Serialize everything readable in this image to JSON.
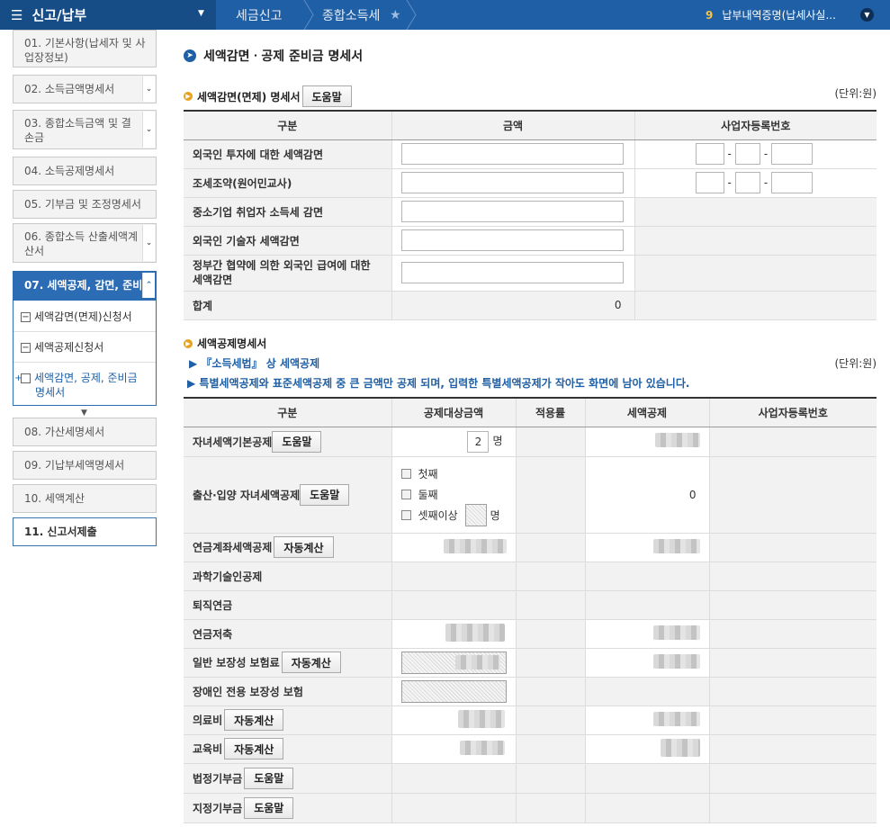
{
  "header": {
    "menu_title": "신고/납부",
    "breadcrumbs": [
      "세금신고",
      "종합소득세"
    ],
    "notify_count": "9",
    "notify_text": "납부내역증명(납세사실...",
    "colors": {
      "bar": "#1f5fa5",
      "menu": "#174d87"
    }
  },
  "sidebar": {
    "steps": [
      {
        "label": "01. 기본사항(납세자 및 사업장정보)"
      },
      {
        "label": "02. 소득금액명세서"
      },
      {
        "label": "03. 종합소득금액 및 결손금"
      },
      {
        "label": "04. 소득공제명세서"
      },
      {
        "label": "05. 기부금 및 조정명세서"
      },
      {
        "label": "06. 종합소득 산출세액계산서"
      },
      {
        "label": "07. 세액공제, 감면, 준비"
      },
      {
        "label": "08. 가산세명세서"
      },
      {
        "label": "09. 기납부세액명세서"
      },
      {
        "label": "10. 세액계산"
      },
      {
        "label": "11. 신고서제출"
      }
    ],
    "subitems": [
      {
        "label": "세액감면(면제)신청서",
        "icon": "−"
      },
      {
        "label": "세액공제신청서",
        "icon": "−"
      },
      {
        "label": "세액감면, 공제, 준비금 명세서",
        "icon": "+"
      }
    ]
  },
  "main": {
    "page_title": "세액감면ㆍ공제 준비금 명세서",
    "section1": {
      "title": "세액감면(면제) 명세서",
      "help_label": "도움말",
      "unit": "(단위:원)",
      "headers": [
        "구분",
        "금액",
        "사업자등록번호"
      ],
      "rows": [
        {
          "label": "외국인 투자에 대한 세액감면"
        },
        {
          "label": "조세조약(원어민교사)"
        },
        {
          "label": "중소기업 취업자 소득세 감면"
        },
        {
          "label": "외국인 기술자 세액감면"
        },
        {
          "label": "정부간 협약에 의한 외국인 급여에 대한 세액감면"
        },
        {
          "label": "합계",
          "value": "0"
        }
      ],
      "dash": "-"
    },
    "section2": {
      "title": "세액공제명세서",
      "note1": "▶ 『소득세법』 상 세액공제",
      "note2": "▶ 특별세액공제와 표준세액공제 중 큰 금액만 공제 되며, 입력한 특별세액공제가 작아도 화면에 남아 있습니다.",
      "unit": "(단위:원)",
      "headers": [
        "구분",
        "공제대상금액",
        "적용률",
        "세액공제",
        "사업자등록번호"
      ],
      "child_count": "2",
      "person_unit": "명",
      "birth_zero": "0",
      "birth_options": [
        "첫째",
        "둘째",
        "셋째이상"
      ],
      "rows": [
        {
          "label": "자녀세액기본공제",
          "btn": "도움말"
        },
        {
          "label": "출산·입양 자녀세액공제",
          "btn": "도움말"
        },
        {
          "label": "연금계좌세액공제",
          "btn": "자동계산"
        },
        {
          "label": "과학기술인공제"
        },
        {
          "label": "퇴직연금"
        },
        {
          "label": "연금저축"
        },
        {
          "label": "일반 보장성 보험료",
          "btn": "자동계산"
        },
        {
          "label": "장애인 전용 보장성 보험"
        },
        {
          "label": "의료비",
          "btn": "자동계산"
        },
        {
          "label": "교육비",
          "btn": "자동계산"
        },
        {
          "label": "법정기부금",
          "btn": "도움말"
        },
        {
          "label": "지정기부금",
          "btn": "도움말"
        }
      ]
    }
  }
}
